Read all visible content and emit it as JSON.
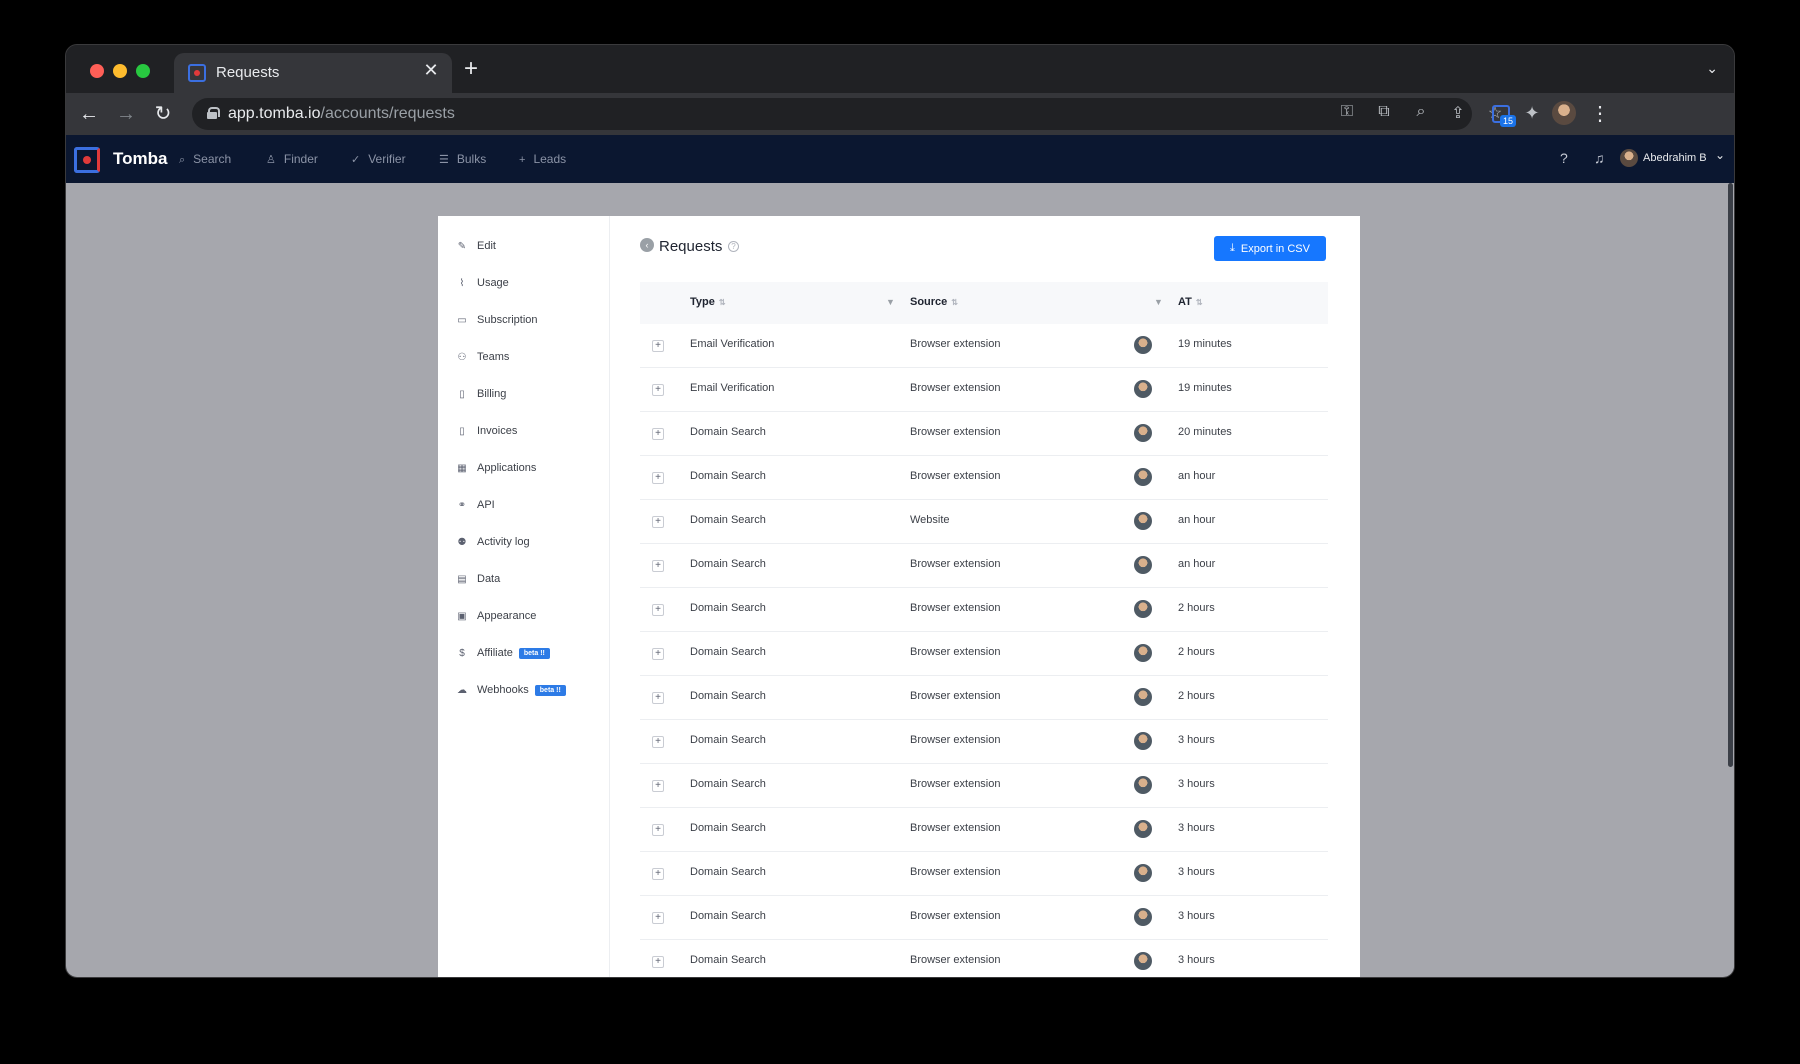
{
  "browser": {
    "tab_title": "Requests",
    "url_host": "app.tomba.io",
    "url_path": "/accounts/requests",
    "extension_badge": "15"
  },
  "app": {
    "brand": "Tomba",
    "nav": [
      {
        "label": "Search",
        "icon": "search-icon"
      },
      {
        "label": "Finder",
        "icon": "user-icon"
      },
      {
        "label": "Verifier",
        "icon": "check-icon"
      },
      {
        "label": "Bulks",
        "icon": "list-icon"
      },
      {
        "label": "Leads",
        "icon": "plus-icon"
      }
    ],
    "user_name": "Abedrahim B"
  },
  "sidebar": {
    "items": [
      {
        "label": "Edit",
        "icon": "edit-icon"
      },
      {
        "label": "Usage",
        "icon": "chart-icon"
      },
      {
        "label": "Subscription",
        "icon": "card-icon"
      },
      {
        "label": "Teams",
        "icon": "team-icon"
      },
      {
        "label": "Billing",
        "icon": "document-icon"
      },
      {
        "label": "Invoices",
        "icon": "file-icon"
      },
      {
        "label": "Applications",
        "icon": "apps-icon"
      },
      {
        "label": "API",
        "icon": "link-icon"
      },
      {
        "label": "Activity log",
        "icon": "activity-icon"
      },
      {
        "label": "Data",
        "icon": "database-icon"
      },
      {
        "label": "Appearance",
        "icon": "layout-icon"
      },
      {
        "label": "Affiliate",
        "icon": "dollar-icon",
        "badge": "beta !!"
      },
      {
        "label": "Webhooks",
        "icon": "cloud-icon",
        "badge": "beta !!"
      }
    ]
  },
  "page": {
    "title": "Requests",
    "export_label": "Export in CSV",
    "columns": {
      "type": "Type",
      "source": "Source",
      "at": "AT"
    },
    "rows": [
      {
        "type": "Email Verification",
        "source": "Browser extension",
        "at": "19 minutes"
      },
      {
        "type": "Email Verification",
        "source": "Browser extension",
        "at": "19 minutes"
      },
      {
        "type": "Domain Search",
        "source": "Browser extension",
        "at": "20 minutes"
      },
      {
        "type": "Domain Search",
        "source": "Browser extension",
        "at": "an hour"
      },
      {
        "type": "Domain Search",
        "source": "Website",
        "at": "an hour"
      },
      {
        "type": "Domain Search",
        "source": "Browser extension",
        "at": "an hour"
      },
      {
        "type": "Domain Search",
        "source": "Browser extension",
        "at": "2 hours"
      },
      {
        "type": "Domain Search",
        "source": "Browser extension",
        "at": "2 hours"
      },
      {
        "type": "Domain Search",
        "source": "Browser extension",
        "at": "2 hours"
      },
      {
        "type": "Domain Search",
        "source": "Browser extension",
        "at": "3 hours"
      },
      {
        "type": "Domain Search",
        "source": "Browser extension",
        "at": "3 hours"
      },
      {
        "type": "Domain Search",
        "source": "Browser extension",
        "at": "3 hours"
      },
      {
        "type": "Domain Search",
        "source": "Browser extension",
        "at": "3 hours"
      },
      {
        "type": "Domain Search",
        "source": "Browser extension",
        "at": "3 hours"
      },
      {
        "type": "Domain Search",
        "source": "Browser extension",
        "at": "3 hours"
      }
    ]
  },
  "colors": {
    "accent": "#1677ff",
    "header_bg": "#0b1730",
    "beta_badge": "#2d7be6"
  }
}
